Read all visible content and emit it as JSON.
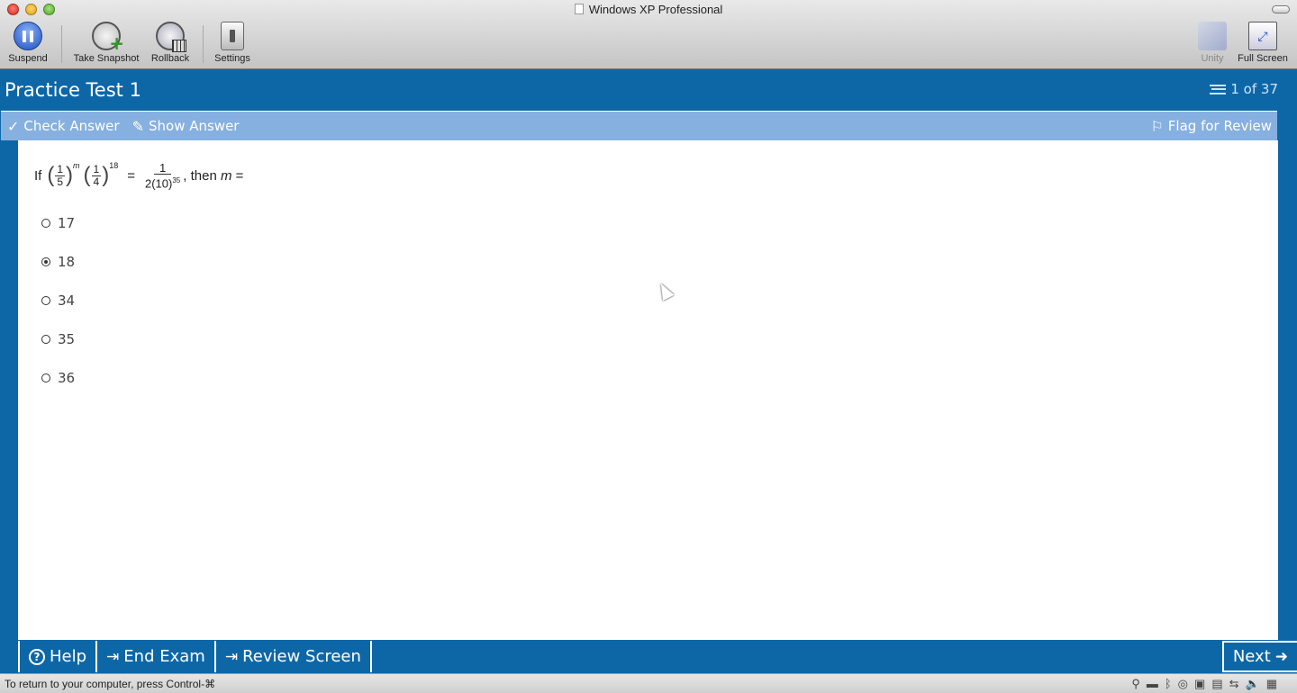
{
  "window": {
    "title": "Windows XP Professional"
  },
  "vm_toolbar": {
    "suspend": "Suspend",
    "take_snapshot": "Take Snapshot",
    "rollback": "Rollback",
    "settings": "Settings",
    "unity": "Unity",
    "full_screen": "Full Screen"
  },
  "exam": {
    "title": "Practice Test 1",
    "counter": "1 of 37"
  },
  "answer_bar": {
    "check_answer": "Check Answer",
    "show_answer": "Show Answer",
    "flag_for_review": "Flag for Review"
  },
  "question": {
    "prefix": "If",
    "frac1_num": "1",
    "frac1_den": "5",
    "exp1": "m",
    "frac2_num": "1",
    "frac2_den": "4",
    "exp2": "18",
    "equals": "=",
    "rhs_num": "1",
    "rhs_den": "2(10)",
    "rhs_den_exp": "35",
    "tail": ", then",
    "var": "m",
    "tail_eq": "="
  },
  "choices": [
    {
      "label": "17",
      "selected": false
    },
    {
      "label": "18",
      "selected": true
    },
    {
      "label": "34",
      "selected": false
    },
    {
      "label": "35",
      "selected": false
    },
    {
      "label": "36",
      "selected": false
    }
  ],
  "nav": {
    "help": "Help",
    "end_exam": "End Exam",
    "review_screen": "Review Screen",
    "next": "Next"
  },
  "status": {
    "message": "To return to your computer, press Control-⌘"
  },
  "icons": {
    "check": "✓",
    "show": "✎",
    "flag": "⚐",
    "arrow_in": "⇥",
    "arrow_next": "➜"
  }
}
